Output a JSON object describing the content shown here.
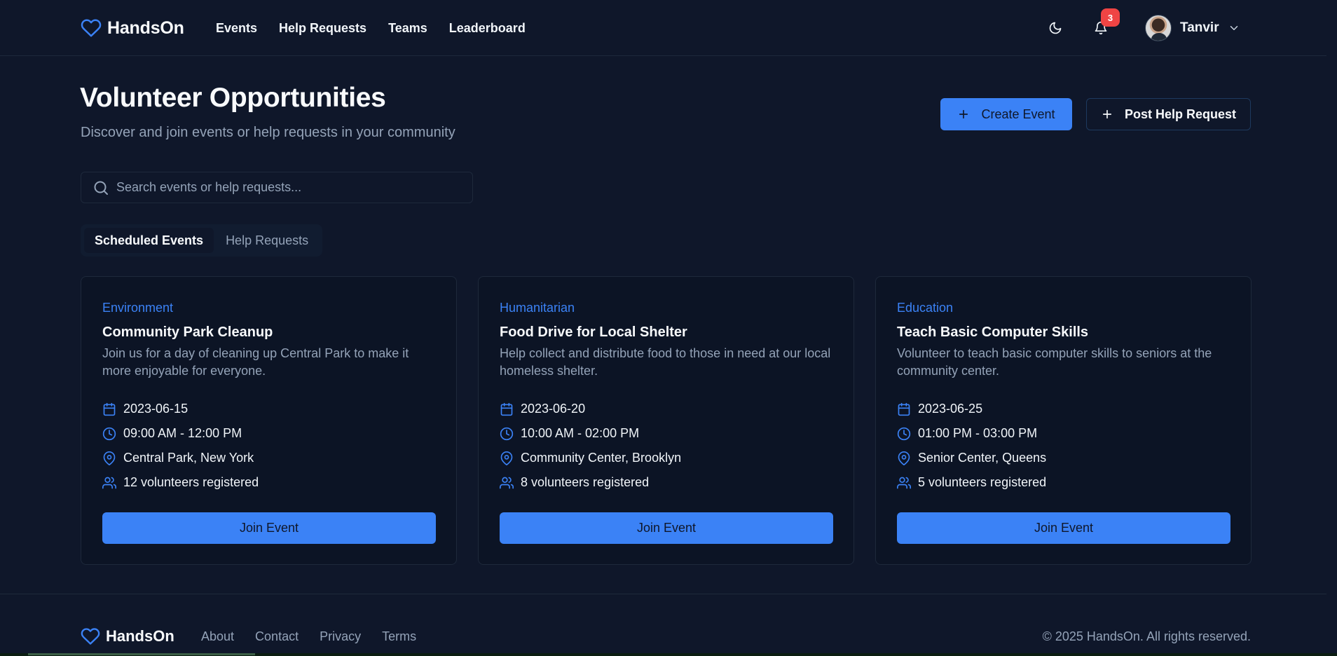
{
  "app": {
    "name": "HandsOn"
  },
  "nav": {
    "links": [
      "Events",
      "Help Requests",
      "Teams",
      "Leaderboard"
    ],
    "notifications_count": "3",
    "user_name": "Tanvir"
  },
  "header": {
    "title": "Volunteer Opportunities",
    "subtitle": "Discover and join events or help requests in your community",
    "create_label": "Create Event",
    "post_label": "Post Help Request"
  },
  "search": {
    "placeholder": "Search events or help requests...",
    "value": ""
  },
  "tabs": [
    {
      "label": "Scheduled Events",
      "active": true
    },
    {
      "label": "Help Requests",
      "active": false
    }
  ],
  "events": [
    {
      "category": "Environment",
      "title": "Community Park Cleanup",
      "description": "Join us for a day of cleaning up Central Park to make it more enjoyable for everyone.",
      "date": "2023-06-15",
      "time": "09:00 AM - 12:00 PM",
      "location": "Central Park, New York",
      "volunteers": "12 volunteers registered",
      "button": "Join Event"
    },
    {
      "category": "Humanitarian",
      "title": "Food Drive for Local Shelter",
      "description": "Help collect and distribute food to those in need at our local homeless shelter.",
      "date": "2023-06-20",
      "time": "10:00 AM - 02:00 PM",
      "location": "Community Center, Brooklyn",
      "volunteers": "8 volunteers registered",
      "button": "Join Event"
    },
    {
      "category": "Education",
      "title": "Teach Basic Computer Skills",
      "description": "Volunteer to teach basic computer skills to seniors at the community center.",
      "date": "2023-06-25",
      "time": "01:00 PM - 03:00 PM",
      "location": "Senior Center, Queens",
      "volunteers": "5 volunteers registered",
      "button": "Join Event"
    }
  ],
  "footer": {
    "brand": "HandsOn",
    "links": [
      "About",
      "Contact",
      "Privacy",
      "Terms"
    ],
    "copyright": "© 2025 HandsOn. All rights reserved."
  },
  "colors": {
    "background": "#0f172a",
    "accent": "#3b82f6",
    "muted_text": "#94a3b8",
    "badge": "#ef4444"
  },
  "icons": [
    "heart-icon",
    "moon-icon",
    "bell-icon",
    "chevron-down-icon",
    "plus-icon",
    "search-icon",
    "calendar-icon",
    "clock-icon",
    "map-pin-icon",
    "users-icon"
  ]
}
